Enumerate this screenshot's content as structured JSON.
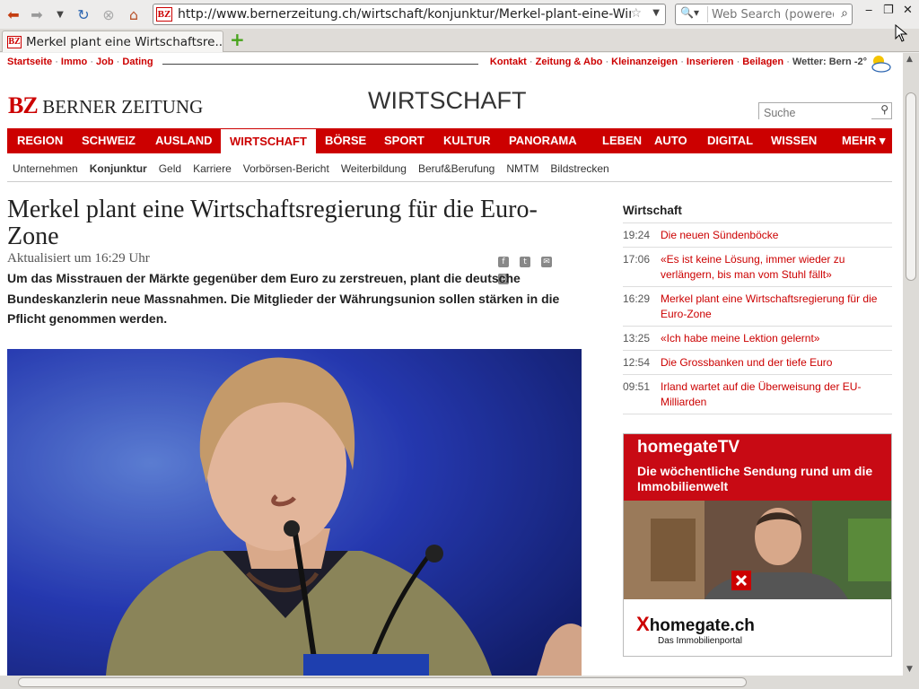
{
  "browser": {
    "url": "http://www.bernerzeitung.ch/wirtschaft/konjunktur/Merkel-plant-eine-Wirtschaftsregierung",
    "search_placeholder": "Web Search (powered",
    "tab_title": "Merkel plant eine Wirtschaftsre..."
  },
  "site": {
    "favicon": "BZ",
    "top_left": [
      "Startseite",
      "Immo",
      "Job",
      "Dating"
    ],
    "top_right": [
      "Kontakt",
      "Zeitung & Abo",
      "Kleinanzeigen",
      "Inserieren",
      "Beilagen"
    ],
    "weather": "Wetter: Bern -2°",
    "logo_bz": "BZ",
    "logo_name": "BERNER ZEITUNG",
    "section": "WIRTSCHAFT",
    "search_placeholder": "Suche"
  },
  "nav": [
    {
      "label": "REGION"
    },
    {
      "label": "SCHWEIZ"
    },
    {
      "label": "AUSLAND"
    },
    {
      "label": "WIRTSCHAFT",
      "active": true
    },
    {
      "label": "BÖRSE"
    },
    {
      "label": "SPORT"
    },
    {
      "label": "KULTUR"
    },
    {
      "label": "PANORAMA"
    },
    {
      "label": "LEBEN"
    },
    {
      "label": "AUTO"
    },
    {
      "label": "DIGITAL"
    },
    {
      "label": "WISSEN"
    },
    {
      "label": "MEHR"
    }
  ],
  "subnav": [
    {
      "label": "Unternehmen"
    },
    {
      "label": "Konjunktur",
      "active": true
    },
    {
      "label": "Geld"
    },
    {
      "label": "Karriere"
    },
    {
      "label": "Vorbörsen-Bericht"
    },
    {
      "label": "Weiterbildung"
    },
    {
      "label": "Beruf&Berufung"
    },
    {
      "label": "NMTM"
    },
    {
      "label": "Bildstrecken"
    }
  ],
  "article": {
    "headline": "Merkel plant eine Wirtschaftsregierung für die Euro-Zone",
    "updated": "Aktualisiert um 16:29 Uhr",
    "lead": "Um das Misstrauen der Märkte gegenüber dem Euro zu zerstreuen, plant die deutsche Bundeskanzlerin neue Massnahmen. Die Mitglieder der Währungsunion sollen stärken in die Pflicht genommen werden."
  },
  "sidebar": {
    "title": "Wirtschaft",
    "items": [
      {
        "time": "19:24",
        "title": "Die neuen Sündenböcke"
      },
      {
        "time": "17:06",
        "title": "«Es ist keine Lösung, immer wieder zu verlängern, bis man vom Stuhl fällt»"
      },
      {
        "time": "16:29",
        "title": "Merkel plant eine Wirtschaftsregierung für die Euro-Zone"
      },
      {
        "time": "13:25",
        "title": "«Ich habe meine Lektion gelernt»"
      },
      {
        "time": "12:54",
        "title": "Die Grossbanken und der tiefe Euro"
      },
      {
        "time": "09:51",
        "title": "Irland wartet auf die Überweisung der EU-Milliarden"
      }
    ]
  },
  "ad": {
    "brand": "homegateTV",
    "subline": "Die wöchentliche Sendung rund um die Immobilienwelt",
    "logo_x": "X",
    "logo": "homegate.ch",
    "tagline": "Das Immobilienportal"
  },
  "colors": {
    "brand_red": "#cc0000",
    "link_red": "#cc0000"
  }
}
